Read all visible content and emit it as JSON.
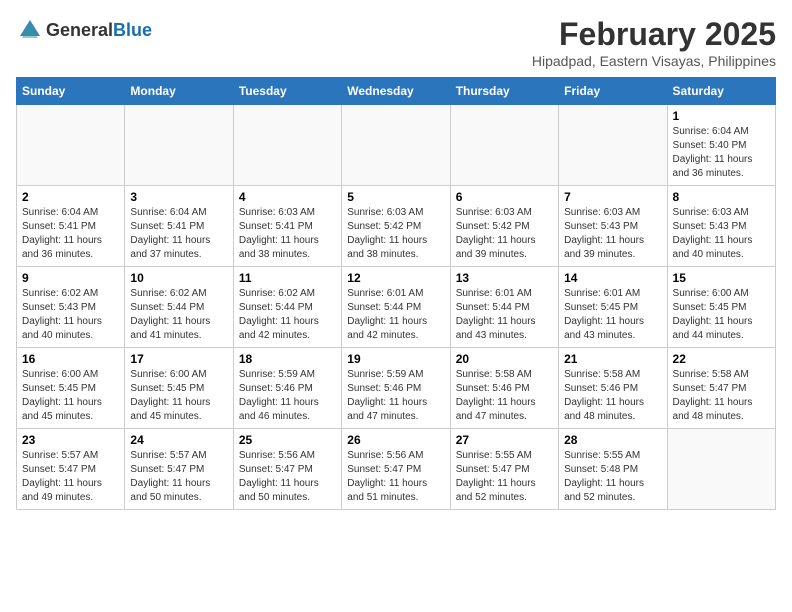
{
  "header": {
    "logo_general": "General",
    "logo_blue": "Blue",
    "month_year": "February 2025",
    "location": "Hipadpad, Eastern Visayas, Philippines"
  },
  "days_of_week": [
    "Sunday",
    "Monday",
    "Tuesday",
    "Wednesday",
    "Thursday",
    "Friday",
    "Saturday"
  ],
  "weeks": [
    [
      {
        "day": "",
        "info": ""
      },
      {
        "day": "",
        "info": ""
      },
      {
        "day": "",
        "info": ""
      },
      {
        "day": "",
        "info": ""
      },
      {
        "day": "",
        "info": ""
      },
      {
        "day": "",
        "info": ""
      },
      {
        "day": "1",
        "info": "Sunrise: 6:04 AM\nSunset: 5:40 PM\nDaylight: 11 hours\nand 36 minutes."
      }
    ],
    [
      {
        "day": "2",
        "info": "Sunrise: 6:04 AM\nSunset: 5:41 PM\nDaylight: 11 hours\nand 36 minutes."
      },
      {
        "day": "3",
        "info": "Sunrise: 6:04 AM\nSunset: 5:41 PM\nDaylight: 11 hours\nand 37 minutes."
      },
      {
        "day": "4",
        "info": "Sunrise: 6:03 AM\nSunset: 5:41 PM\nDaylight: 11 hours\nand 38 minutes."
      },
      {
        "day": "5",
        "info": "Sunrise: 6:03 AM\nSunset: 5:42 PM\nDaylight: 11 hours\nand 38 minutes."
      },
      {
        "day": "6",
        "info": "Sunrise: 6:03 AM\nSunset: 5:42 PM\nDaylight: 11 hours\nand 39 minutes."
      },
      {
        "day": "7",
        "info": "Sunrise: 6:03 AM\nSunset: 5:43 PM\nDaylight: 11 hours\nand 39 minutes."
      },
      {
        "day": "8",
        "info": "Sunrise: 6:03 AM\nSunset: 5:43 PM\nDaylight: 11 hours\nand 40 minutes."
      }
    ],
    [
      {
        "day": "9",
        "info": "Sunrise: 6:02 AM\nSunset: 5:43 PM\nDaylight: 11 hours\nand 40 minutes."
      },
      {
        "day": "10",
        "info": "Sunrise: 6:02 AM\nSunset: 5:44 PM\nDaylight: 11 hours\nand 41 minutes."
      },
      {
        "day": "11",
        "info": "Sunrise: 6:02 AM\nSunset: 5:44 PM\nDaylight: 11 hours\nand 42 minutes."
      },
      {
        "day": "12",
        "info": "Sunrise: 6:01 AM\nSunset: 5:44 PM\nDaylight: 11 hours\nand 42 minutes."
      },
      {
        "day": "13",
        "info": "Sunrise: 6:01 AM\nSunset: 5:44 PM\nDaylight: 11 hours\nand 43 minutes."
      },
      {
        "day": "14",
        "info": "Sunrise: 6:01 AM\nSunset: 5:45 PM\nDaylight: 11 hours\nand 43 minutes."
      },
      {
        "day": "15",
        "info": "Sunrise: 6:00 AM\nSunset: 5:45 PM\nDaylight: 11 hours\nand 44 minutes."
      }
    ],
    [
      {
        "day": "16",
        "info": "Sunrise: 6:00 AM\nSunset: 5:45 PM\nDaylight: 11 hours\nand 45 minutes."
      },
      {
        "day": "17",
        "info": "Sunrise: 6:00 AM\nSunset: 5:45 PM\nDaylight: 11 hours\nand 45 minutes."
      },
      {
        "day": "18",
        "info": "Sunrise: 5:59 AM\nSunset: 5:46 PM\nDaylight: 11 hours\nand 46 minutes."
      },
      {
        "day": "19",
        "info": "Sunrise: 5:59 AM\nSunset: 5:46 PM\nDaylight: 11 hours\nand 47 minutes."
      },
      {
        "day": "20",
        "info": "Sunrise: 5:58 AM\nSunset: 5:46 PM\nDaylight: 11 hours\nand 47 minutes."
      },
      {
        "day": "21",
        "info": "Sunrise: 5:58 AM\nSunset: 5:46 PM\nDaylight: 11 hours\nand 48 minutes."
      },
      {
        "day": "22",
        "info": "Sunrise: 5:58 AM\nSunset: 5:47 PM\nDaylight: 11 hours\nand 48 minutes."
      }
    ],
    [
      {
        "day": "23",
        "info": "Sunrise: 5:57 AM\nSunset: 5:47 PM\nDaylight: 11 hours\nand 49 minutes."
      },
      {
        "day": "24",
        "info": "Sunrise: 5:57 AM\nSunset: 5:47 PM\nDaylight: 11 hours\nand 50 minutes."
      },
      {
        "day": "25",
        "info": "Sunrise: 5:56 AM\nSunset: 5:47 PM\nDaylight: 11 hours\nand 50 minutes."
      },
      {
        "day": "26",
        "info": "Sunrise: 5:56 AM\nSunset: 5:47 PM\nDaylight: 11 hours\nand 51 minutes."
      },
      {
        "day": "27",
        "info": "Sunrise: 5:55 AM\nSunset: 5:47 PM\nDaylight: 11 hours\nand 52 minutes."
      },
      {
        "day": "28",
        "info": "Sunrise: 5:55 AM\nSunset: 5:48 PM\nDaylight: 11 hours\nand 52 minutes."
      },
      {
        "day": "",
        "info": ""
      }
    ]
  ]
}
